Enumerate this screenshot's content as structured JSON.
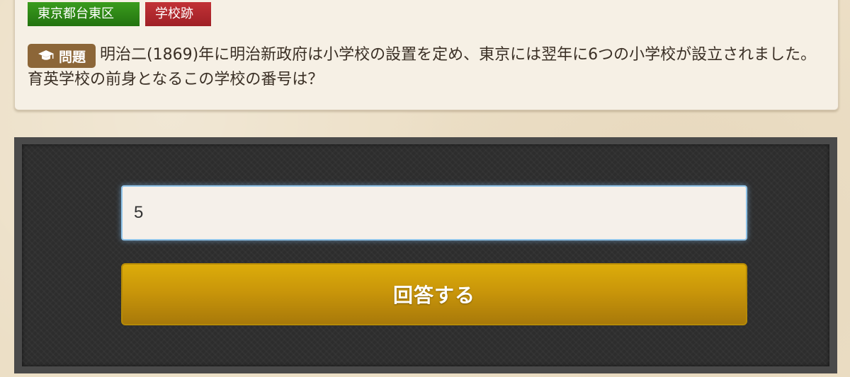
{
  "tags": {
    "area": "東京都台東区",
    "category": "学校跡"
  },
  "question": {
    "badge_label": "問題",
    "badge_icon": "graduation-cap-icon",
    "text": "明治二(1869)年に明治新政府は小学校の設置を定め、東京には翌年に6つの小学校が設立されました。育英学校の前身となるこの学校の番号は？"
  },
  "answer": {
    "value": "5",
    "submit_label": "回答する"
  },
  "colors": {
    "area_tag": "#2e8a16",
    "category_tag": "#b32a2e",
    "badge": "#8c6638",
    "submit_button": "#d1a00a",
    "panel": "#2d2d2d"
  }
}
